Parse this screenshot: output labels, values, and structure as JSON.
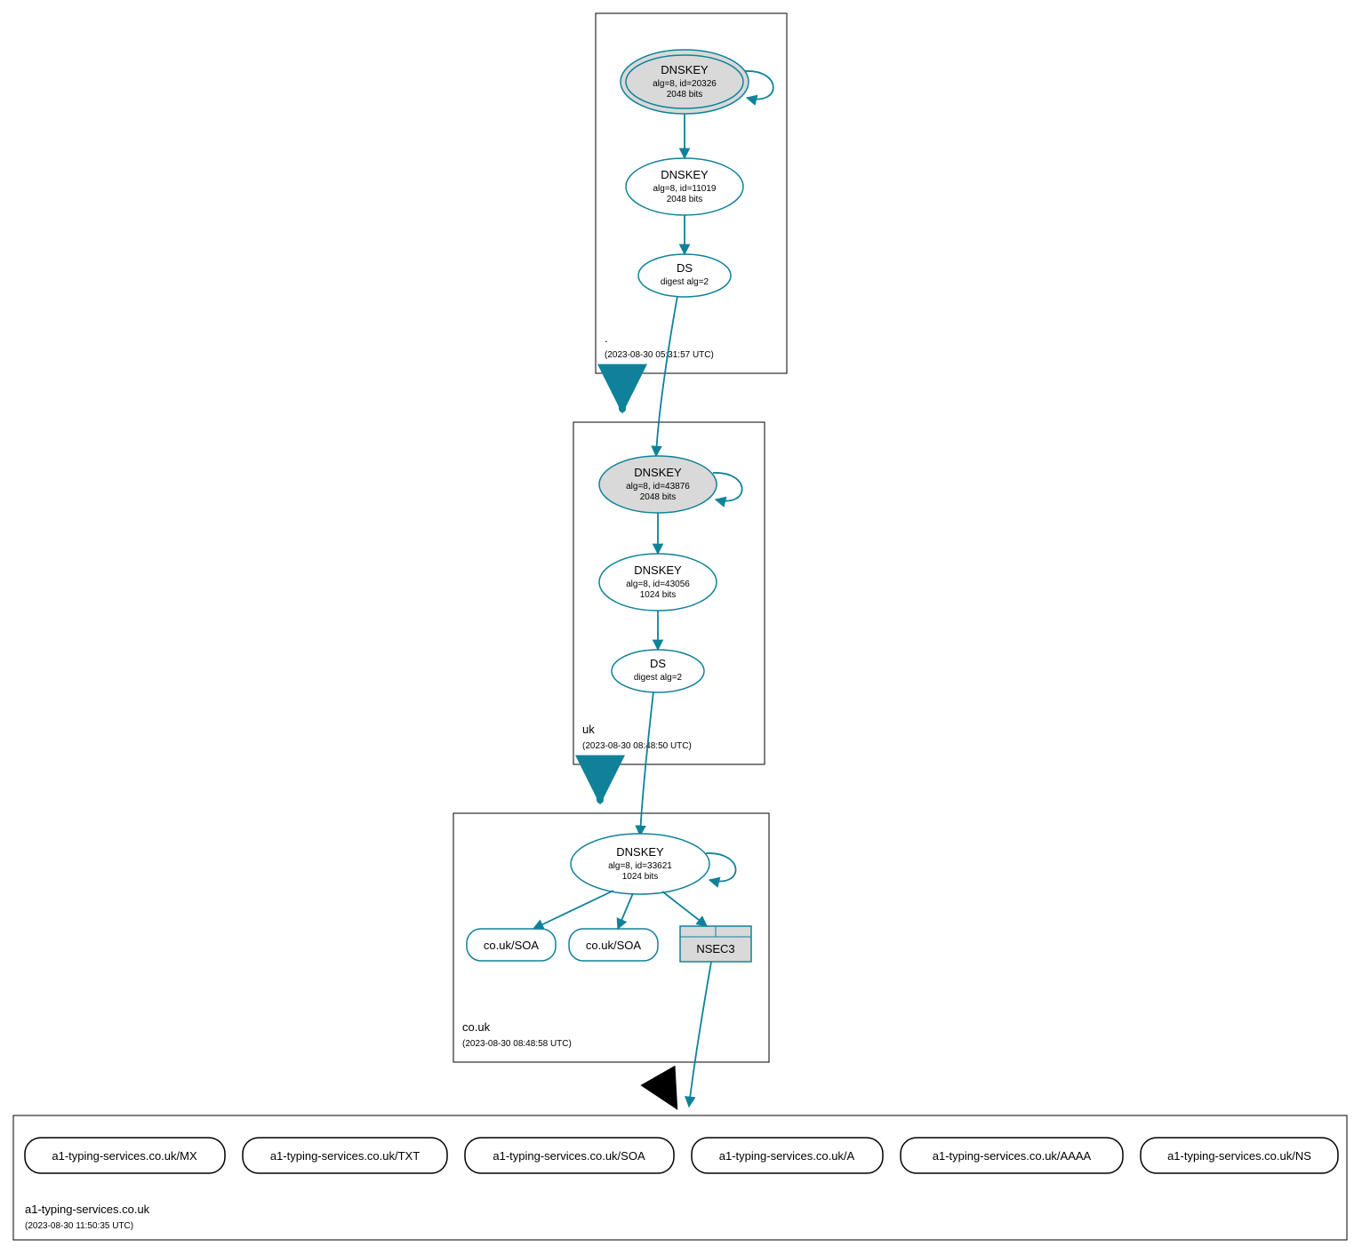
{
  "colors": {
    "teal": "#0f8299",
    "grey": "#d9d9d9",
    "black": "#000000"
  },
  "zones": {
    "root": {
      "label": ".",
      "ts": "(2023-08-30 05:31:57 UTC)"
    },
    "uk": {
      "label": "uk",
      "ts": "(2023-08-30 08:48:50 UTC)"
    },
    "couk": {
      "label": "co.uk",
      "ts": "(2023-08-30 08:48:58 UTC)"
    },
    "leaf": {
      "label": "a1-typing-services.co.uk",
      "ts": "(2023-08-30 11:50:35 UTC)"
    }
  },
  "nodes": {
    "root_ksk": {
      "title": "DNSKEY",
      "l1": "alg=8, id=20326",
      "l2": "2048 bits"
    },
    "root_zsk": {
      "title": "DNSKEY",
      "l1": "alg=8, id=11019",
      "l2": "2048 bits"
    },
    "root_ds": {
      "title": "DS",
      "l1": "digest alg=2"
    },
    "uk_ksk": {
      "title": "DNSKEY",
      "l1": "alg=8, id=43876",
      "l2": "2048 bits"
    },
    "uk_zsk": {
      "title": "DNSKEY",
      "l1": "alg=8, id=43056",
      "l2": "1024 bits"
    },
    "uk_ds": {
      "title": "DS",
      "l1": "digest alg=2"
    },
    "couk_key": {
      "title": "DNSKEY",
      "l1": "alg=8, id=33621",
      "l2": "1024 bits"
    },
    "couk_soa1": {
      "title": "co.uk/SOA"
    },
    "couk_soa2": {
      "title": "co.uk/SOA"
    },
    "couk_nsec": {
      "title": "NSEC3"
    },
    "leaf_mx": {
      "title": "a1-typing-services.co.uk/MX"
    },
    "leaf_txt": {
      "title": "a1-typing-services.co.uk/TXT"
    },
    "leaf_soa": {
      "title": "a1-typing-services.co.uk/SOA"
    },
    "leaf_a": {
      "title": "a1-typing-services.co.uk/A"
    },
    "leaf_aaaa": {
      "title": "a1-typing-services.co.uk/AAAA"
    },
    "leaf_ns": {
      "title": "a1-typing-services.co.uk/NS"
    }
  }
}
